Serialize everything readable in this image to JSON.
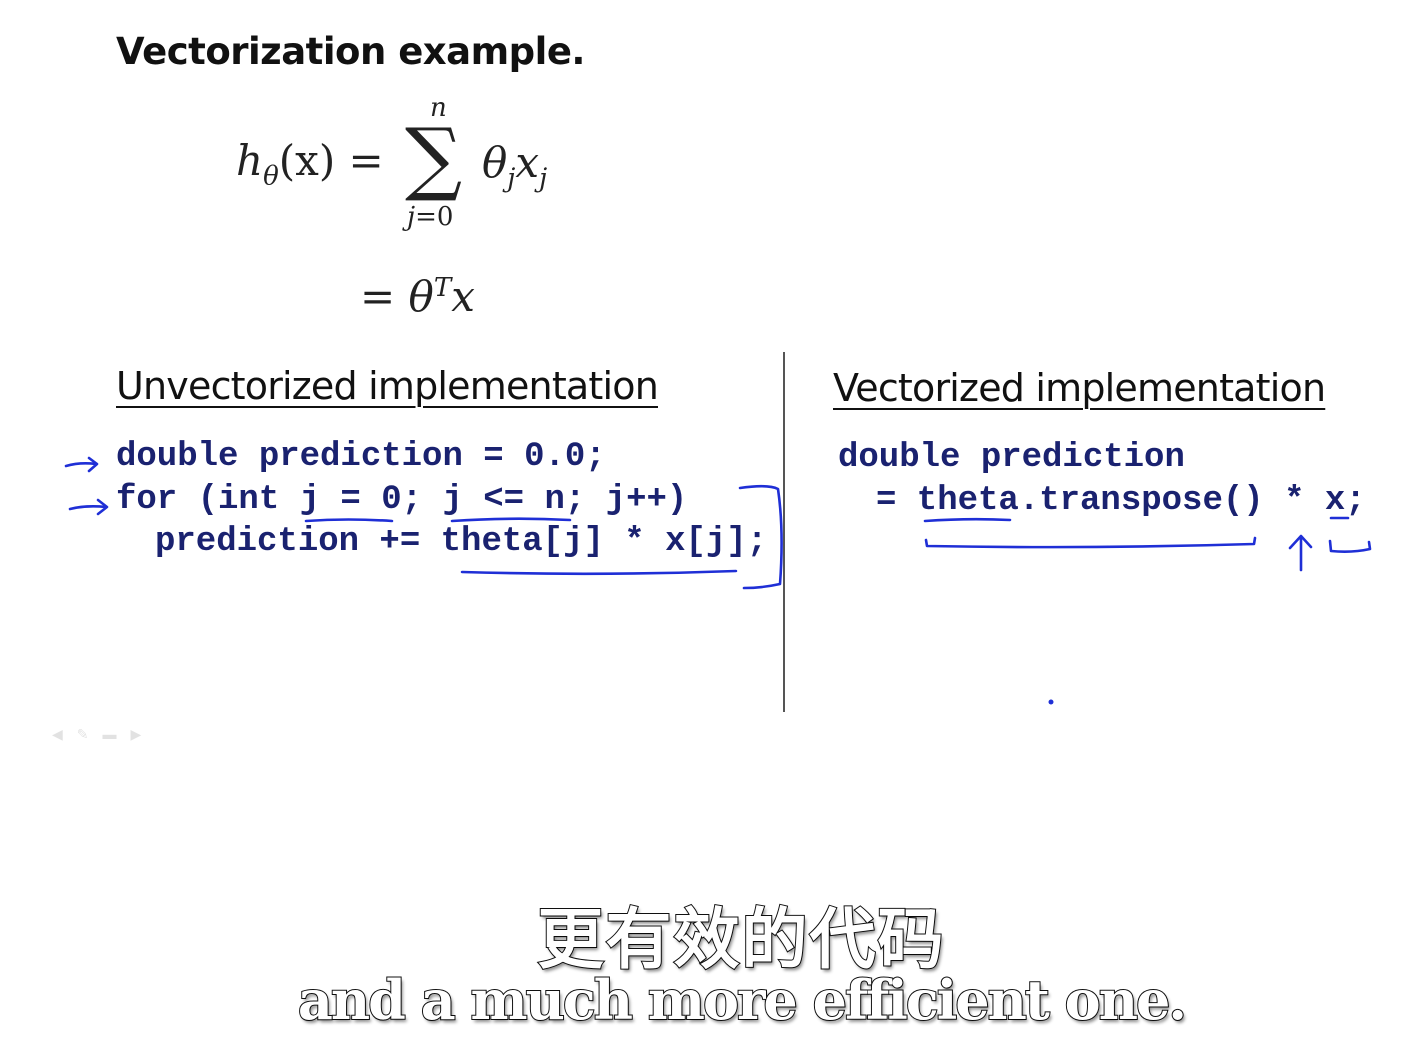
{
  "slide": {
    "title": "Vectorization example."
  },
  "equation": {
    "lhs_h": "h",
    "lhs_sub": "θ",
    "lhs_arg": "(x) =",
    "sum_sign": "∑",
    "sum_upper": "n",
    "sum_lower_var": "j",
    "sum_lower_rest": "=0",
    "rhs_theta": "θ",
    "rhs_sub_j1": "j",
    "rhs_x": "x",
    "rhs_sub_j2": "j",
    "line2_eq": "= ",
    "line2_theta": "θ",
    "line2_sup": "T",
    "line2_x": "x"
  },
  "unvectorized": {
    "heading": "Unvectorized implementation",
    "code": [
      "double prediction = 0.0;",
      "for (int j = 0; j <= n; j++)",
      "prediction += theta[j] * x[j];"
    ]
  },
  "vectorized": {
    "heading": "Vectorized implementation",
    "code": [
      "double prediction",
      "= theta.transpose() * x;"
    ]
  },
  "subtitles": {
    "chinese": "更有效的代码",
    "english": "and a much more efficient one."
  },
  "colors": {
    "code_text": "#1a2270",
    "ink": "#1f2fd6"
  }
}
